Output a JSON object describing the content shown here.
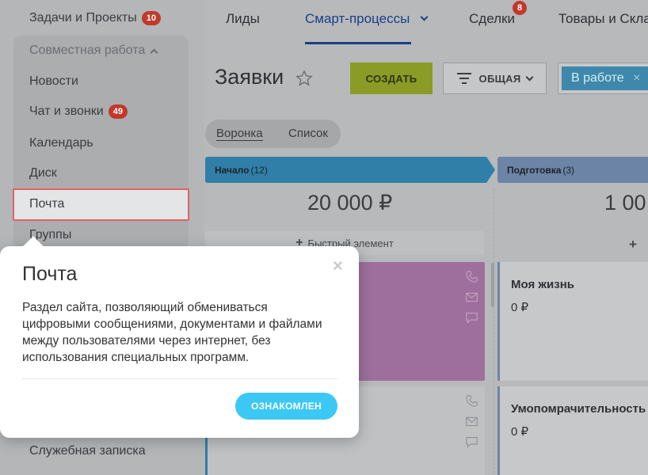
{
  "sidebar": {
    "tasks": {
      "label": "Задачи и Проекты",
      "count": "10"
    },
    "group_title": "Совместная работа",
    "items": [
      {
        "label": "Новости"
      },
      {
        "label": "Чат и звонки",
        "count": "49"
      },
      {
        "label": "Календарь"
      },
      {
        "label": "Диск"
      },
      {
        "label": "Почта"
      },
      {
        "label": "Группы"
      }
    ],
    "bottom_item": "Служебная записка"
  },
  "topnav": {
    "tabs": [
      {
        "label": "Лиды"
      },
      {
        "label": "Смарт-процессы"
      },
      {
        "label": "Сделки",
        "badge": "8"
      },
      {
        "label": "Товары и Скла"
      }
    ]
  },
  "page": {
    "title": "Заявки",
    "create_label": "СОЗДАТЬ",
    "filter_label": "ОБЩАЯ",
    "status_chip": "В работе",
    "status_chip_remove": "×",
    "views": [
      "Воронка",
      "Список"
    ]
  },
  "kanban": {
    "columns": [
      {
        "name": "Начало",
        "count": "(12)",
        "sum": "20 000 ₽",
        "color": "#2f7fa8"
      },
      {
        "name": "Подготовка",
        "count": "(3)",
        "sum": "1 00",
        "color": "#6c84a6"
      }
    ],
    "quick_add_label": "Быстрый элемент",
    "quick_add_plus": "+",
    "cards": [
      {
        "title": "Моя жизнь",
        "price": "0 ₽"
      },
      {
        "title": "Умопомрачительность",
        "price": "0 ₽"
      }
    ]
  },
  "popup": {
    "title": "Почта",
    "text": "Раздел сайта, позволяющий обмениваться цифровыми сообщениями, документами и файлами между пользователями через интернет, без использования специальных программ.",
    "button_label": "ОЗНАКОМЛЕН",
    "close": "×"
  },
  "colors": {
    "accent_blue": "#3bc8f5",
    "create_green": "#8a9c25",
    "counter_red": "#c0392b",
    "highlight_border": "#e06363"
  }
}
